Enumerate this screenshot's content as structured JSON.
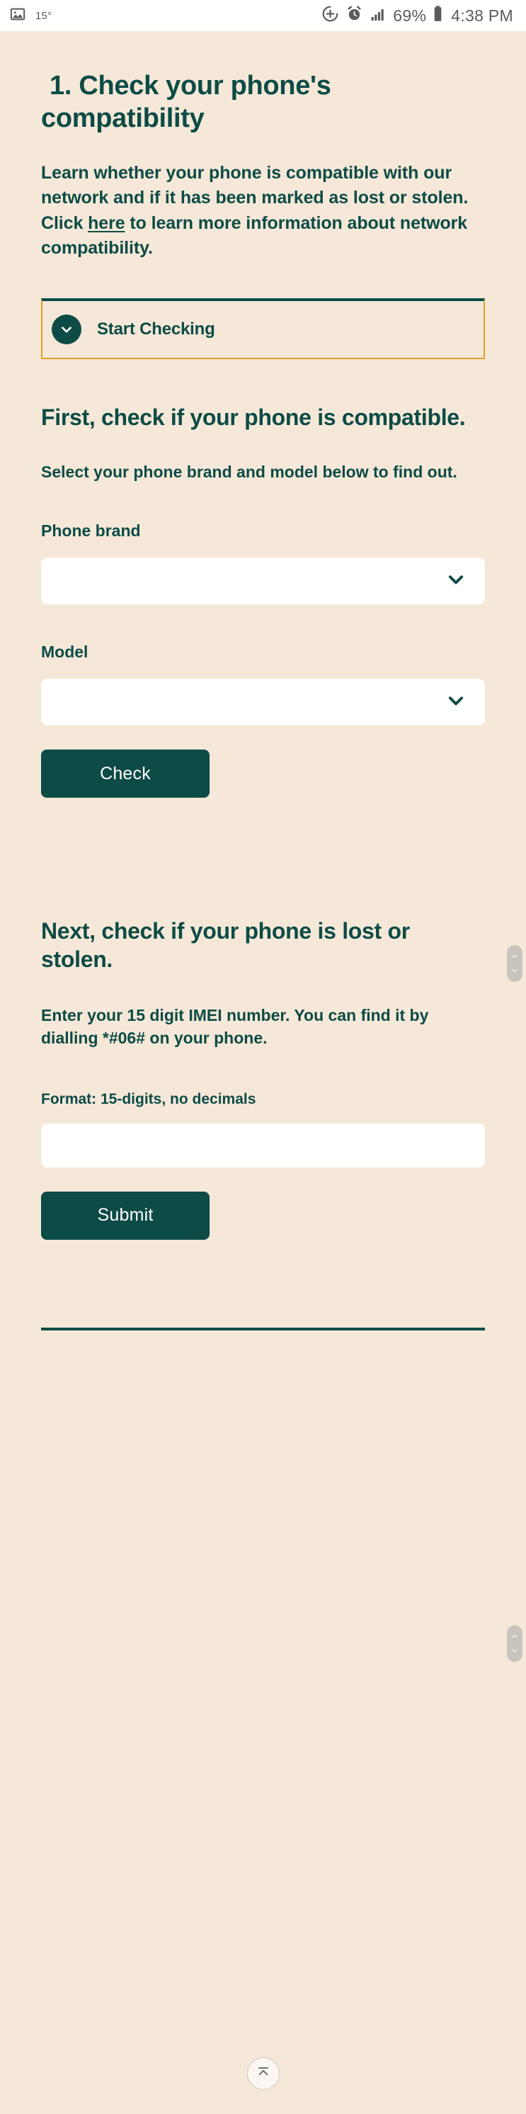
{
  "status_bar": {
    "temperature": "15°",
    "battery_percent": "69%",
    "time": "4:38 PM",
    "icons": [
      "image-icon",
      "download-progress-icon",
      "alarm-icon",
      "signal-icon",
      "battery-icon"
    ]
  },
  "page": {
    "heading": "1. Check your phone's compatibility",
    "intro": {
      "part1": "Learn whether your phone is compatible with our network and if it has been marked as lost or stolen. Click ",
      "link": "here",
      "part2": " to learn more information about network compatibility."
    },
    "accordion": {
      "label": "Start Checking",
      "icon": "chevron-down-icon",
      "border_color": "#e0a028",
      "top_border_color": "#0d4b46"
    },
    "section_one": {
      "heading": "First, check if your phone is compatible.",
      "subtext": "Select your phone brand and model below to find out.",
      "brand_label": "Phone brand",
      "brand_value": "",
      "model_label": "Model",
      "model_value": "",
      "button_label": "Check"
    },
    "section_two": {
      "heading": "Next, check if your phone is lost or stolen.",
      "subtext": "Enter your 15 digit IMEI number. You can find it by dialling *#06# on your phone.",
      "format_label": "Format: 15-digits, no decimals",
      "imei_value": "",
      "imei_placeholder": "",
      "button_label": "Submit"
    },
    "scroll_to_top_icon": "arrow-to-top-icon",
    "colors": {
      "background": "#f5e8d8",
      "brand_teal": "#0d4b46",
      "accent_amber": "#e0a028",
      "field_white": "#ffffff"
    }
  }
}
